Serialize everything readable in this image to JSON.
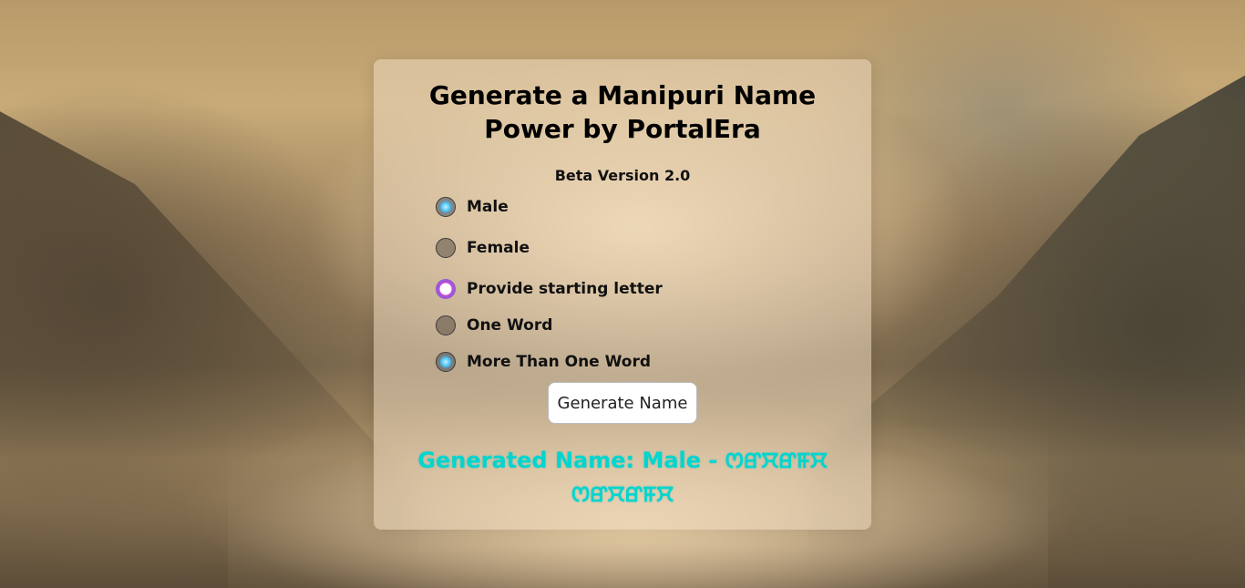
{
  "card": {
    "title_line1": "Generate a Manipuri Name",
    "title_line2": "Power by PortalEra",
    "version": "Beta Version 2.0"
  },
  "options": {
    "male": {
      "label": "Male",
      "checked": true
    },
    "female": {
      "label": "Female",
      "checked": false
    },
    "starting_letter": {
      "label": "Provide starting letter",
      "checked": true
    },
    "one_word": {
      "label": "One Word",
      "checked": false
    },
    "more_than_one_word": {
      "label": "More Than One Word",
      "checked": true
    }
  },
  "generate_button": {
    "label": "Generate Name"
  },
  "result": {
    "text": "Generated Name: Male - ꯁꯔꯆꯔꯝꯆ ꯁꯔꯆꯔꯝꯆ"
  },
  "colors": {
    "result_text": "#00d5cf",
    "radio_accent_blue": "#4aa6d6",
    "radio_accent_purple": "#c24cd8"
  }
}
